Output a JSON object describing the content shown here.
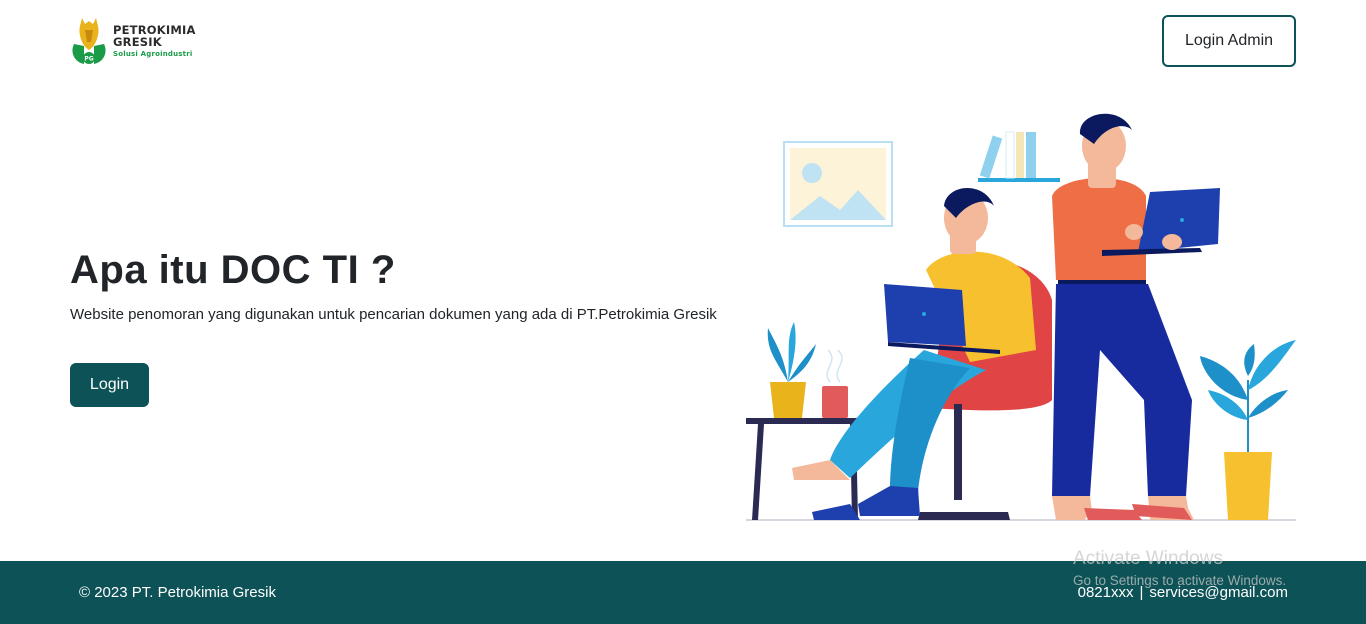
{
  "brand": {
    "logo_icon": "petrokimia-gresik-logo",
    "name_line1": "PETROKIMIA",
    "name_line2": "GRESIK",
    "tagline": "Solusi Agroindustri",
    "logo_mark_text": "PG"
  },
  "header": {
    "login_admin_label": "Login Admin"
  },
  "hero": {
    "title": "Apa itu DOC TI ?",
    "description": "Website penomoran yang digunakan untuk pencarian dokumen yang ada di PT.Petrokimia Gresik",
    "login_label": "Login",
    "illustration_icon": "people-working-on-laptops-illustration"
  },
  "footer": {
    "copyright": "© 2023 PT. Petrokimia Gresik",
    "phone": "0821xxx",
    "separator": "|",
    "email": "services@gmail.com"
  },
  "os_watermark": {
    "line1": "Activate Windows",
    "line2": "Go to Settings to activate Windows."
  },
  "colors": {
    "primary": "#0d5257",
    "brand_green": "#1a9b48",
    "text": "#212529"
  }
}
